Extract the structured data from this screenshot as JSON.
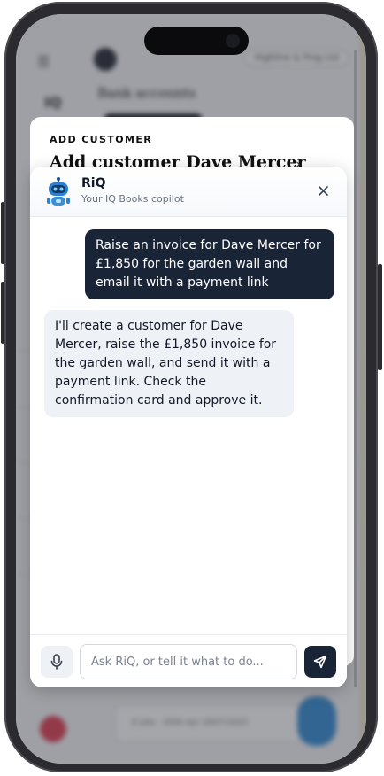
{
  "background": {
    "company_label": "Highline & Frog Ltd",
    "page_title": "Bank accounts",
    "side_logo": "IQ",
    "bottom_text": "8 jobs · £90k     Apr 28/07/2025"
  },
  "sheet": {
    "eyebrow": "ADD CUSTOMER",
    "title": "Add customer Dave Mercer"
  },
  "chat": {
    "name": "RiQ",
    "subtitle": "Your IQ Books copilot",
    "messages": [
      {
        "role": "user",
        "text": "Raise an invoice for Dave Mercer for £1,850 for the garden wall and email it with a payment link"
      },
      {
        "role": "assistant",
        "text": "I'll create a customer for Dave Mercer, raise the £1,850 invoice for the garden wall, and send it with a payment link. Check the confirmation card and approve it."
      }
    ],
    "input": {
      "placeholder": "Ask RiQ, or tell it what to do...",
      "value": ""
    }
  },
  "colors": {
    "primary_dark": "#1a2437",
    "bubble_light": "#eef1f5",
    "bot_blue": "#3b8fd6"
  },
  "icons": {
    "menu": "menu-icon",
    "bot": "robot-icon",
    "close": "close-icon",
    "mic": "microphone-icon",
    "send": "send-icon"
  }
}
